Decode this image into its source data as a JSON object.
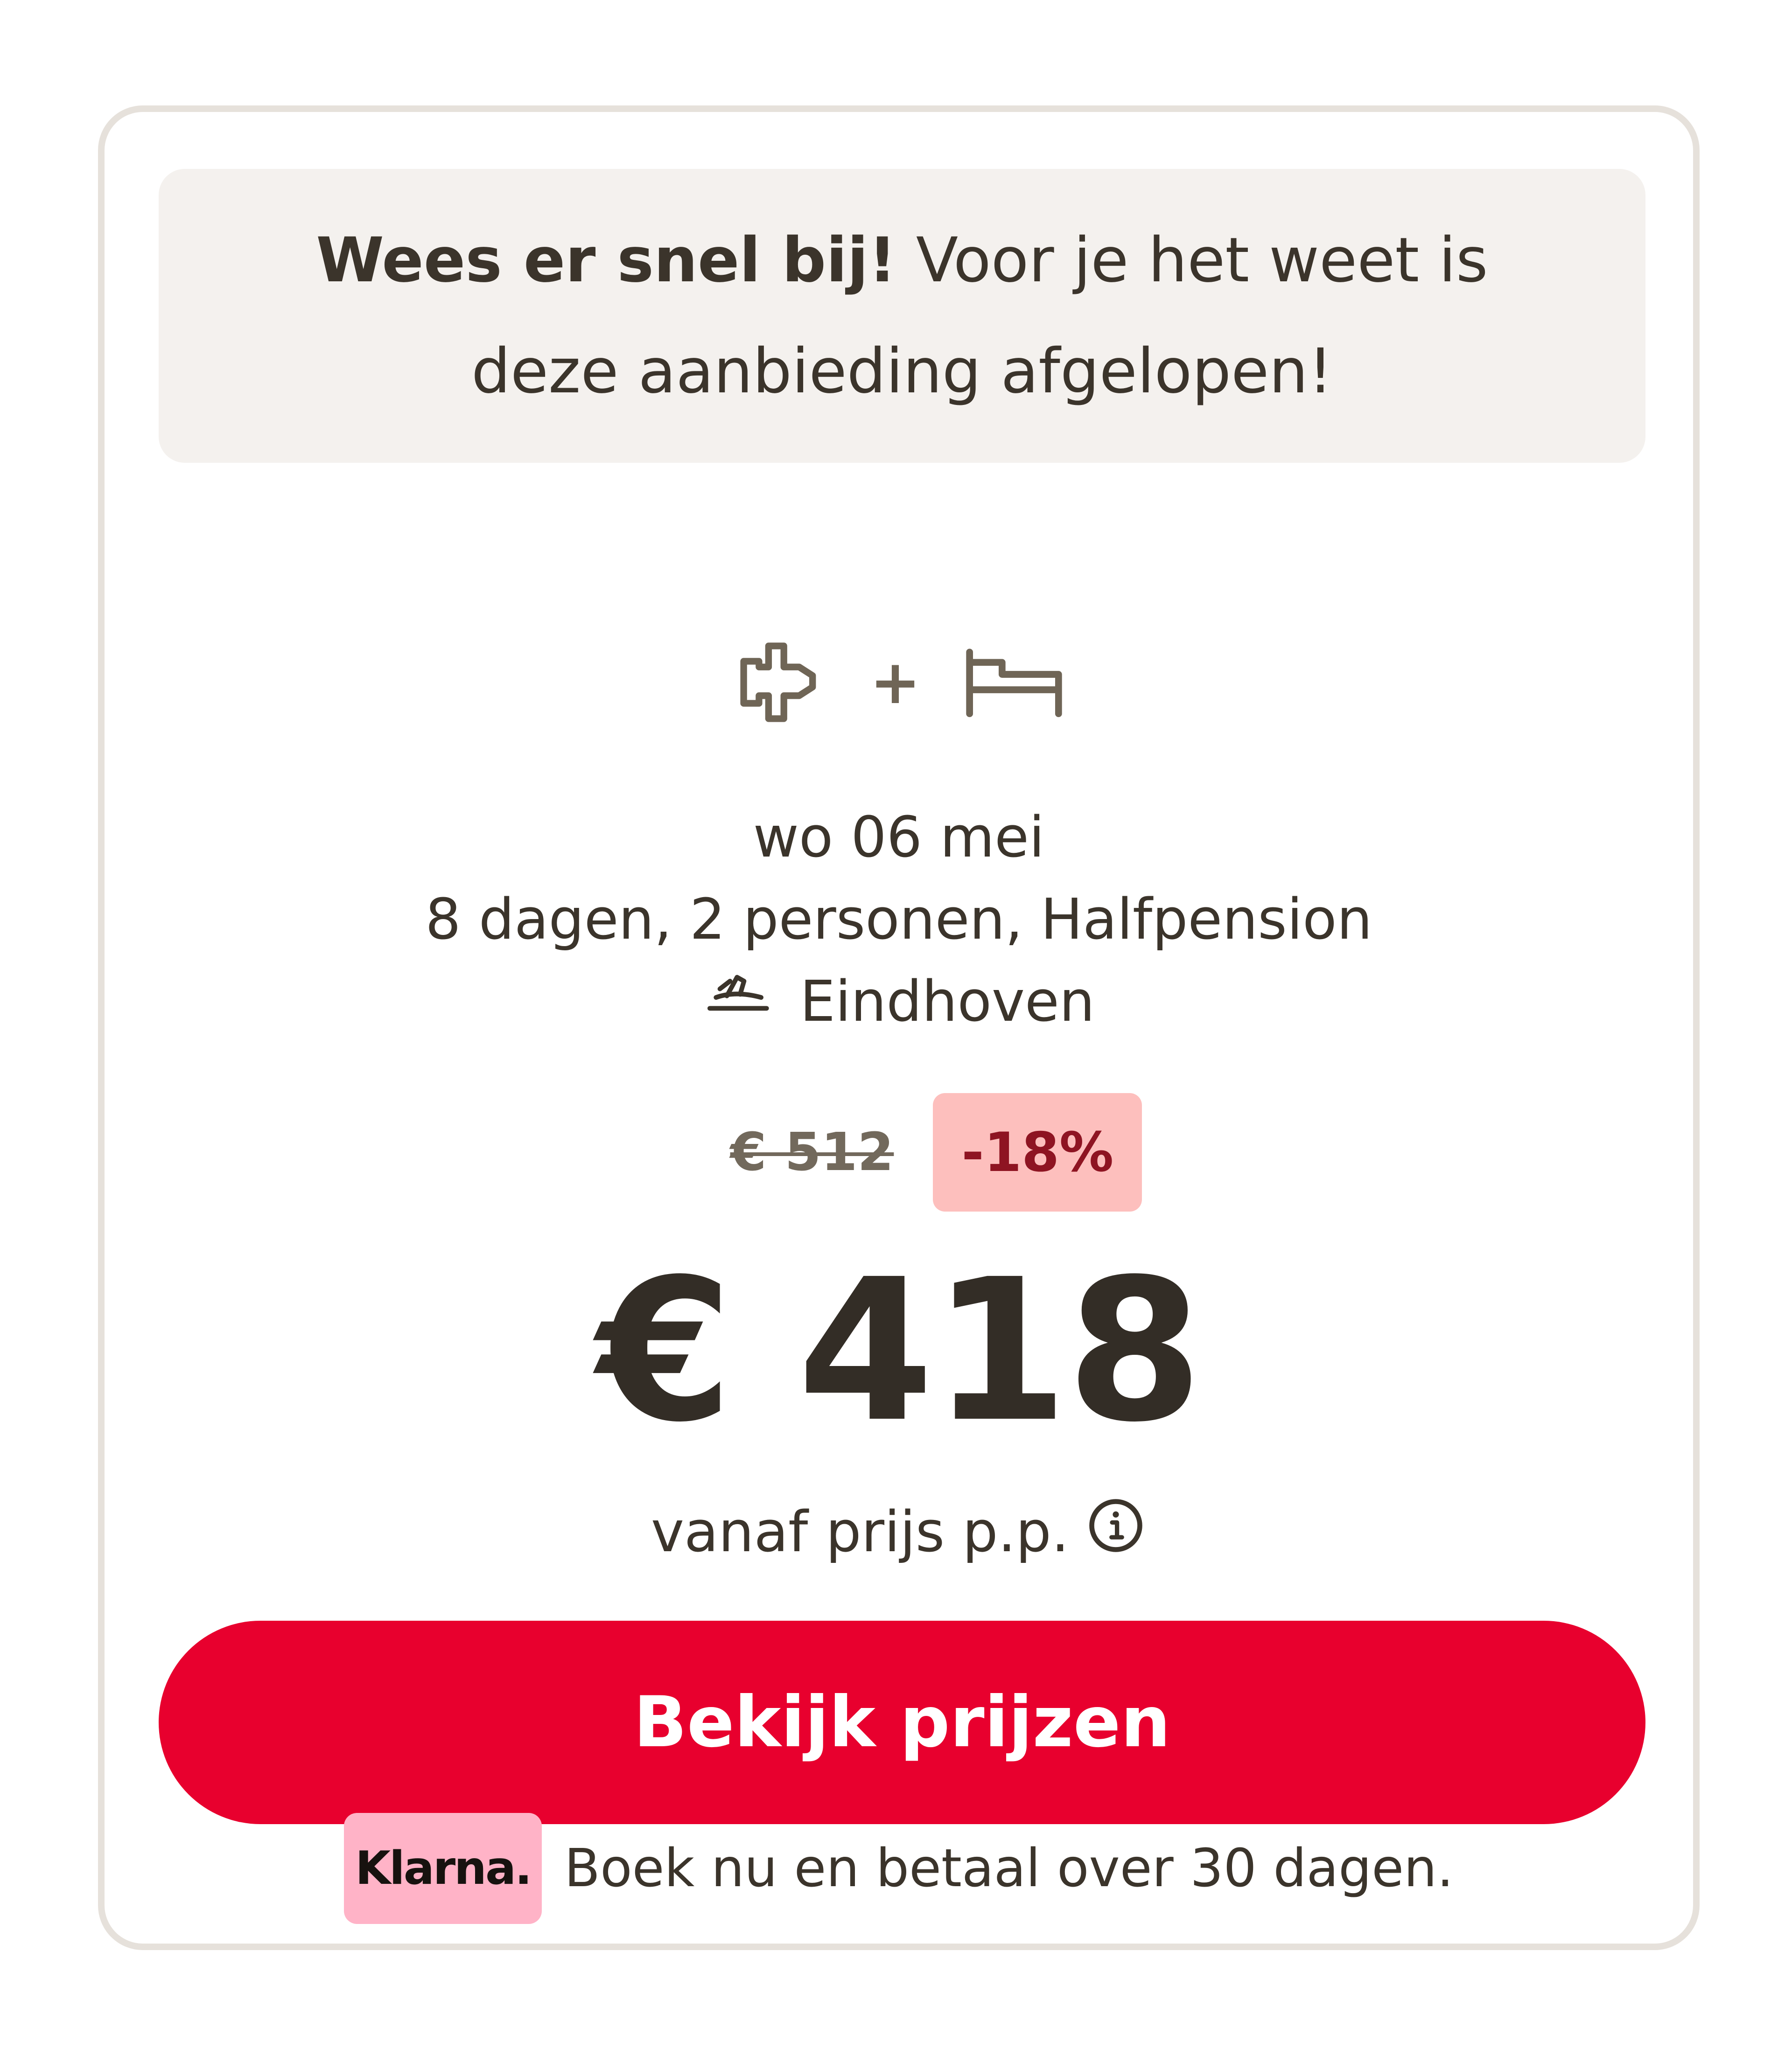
{
  "urgency": {
    "bold": "Wees er snel bij!",
    "text": " Voor je het weet is deze aanbieding afgelopen!"
  },
  "product": {
    "flight_icon": "airplane-icon",
    "plus": "+",
    "hotel_icon": "bed-icon"
  },
  "trip": {
    "date": "wo 06 mei",
    "details": "8 dagen, 2 personen, Halfpension",
    "departure_icon": "departure-icon",
    "departure_airport": "Eindhoven"
  },
  "pricing": {
    "old_price": "€ 512",
    "discount": "-18%",
    "price": "€ 418",
    "caption": "vanaf prijs p.p.",
    "info_icon": "info-icon"
  },
  "cta": {
    "label": "Bekijk prijzen"
  },
  "klarna": {
    "logo": "Klarna.",
    "text": "Boek nu en betaal over 30 dagen."
  },
  "colors": {
    "accent": "#e8002e",
    "discount_bg": "#fdbfbd",
    "discount_text": "#8e1422",
    "klarna_pink": "#ffb3c7",
    "card_border": "#e6e1db",
    "notice_bg": "#f4f1ee",
    "text": "#3b342b"
  }
}
